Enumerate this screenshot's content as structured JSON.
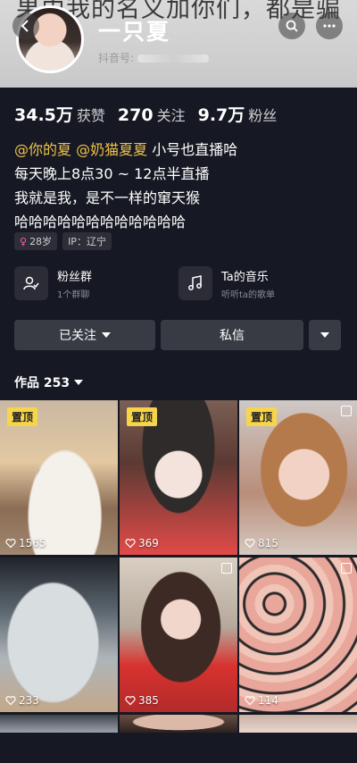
{
  "banner": {
    "text": "果由我的名义加你们，都是骗"
  },
  "profile": {
    "username": "一只夏",
    "douyin_id_label": "抖音号:"
  },
  "stats": [
    {
      "num": "34.5万",
      "label": "获赞"
    },
    {
      "num": "270",
      "label": "关注"
    },
    {
      "num": "9.7万",
      "label": "粉丝"
    }
  ],
  "bio": {
    "mention1": "@你的夏",
    "mention2": "@奶猫夏夏",
    "line1_rest": " 小号也直播哈",
    "line2": "每天晚上8点30 ~ 12点半直播",
    "line3": "我就是我，是不一样的窜天猴",
    "line4": "哈哈哈哈哈哈哈哈哈哈哈哈"
  },
  "tags": {
    "age": "28岁",
    "ip": "IP：辽宁",
    "gender_icon": "female-icon"
  },
  "cards": [
    {
      "title": "粉丝群",
      "sub": "1个群聊",
      "icon": "fan-group-icon"
    },
    {
      "title": "Ta的音乐",
      "sub": "听听ta的歌单",
      "icon": "music-note-icon"
    }
  ],
  "actions": {
    "follow": "已关注",
    "message": "私信"
  },
  "works": {
    "label": "作品 253"
  },
  "grid": [
    {
      "pin": "置顶",
      "likes": "1565"
    },
    {
      "pin": "置顶",
      "likes": "369"
    },
    {
      "pin": "置顶",
      "likes": "815"
    },
    {
      "likes": "233"
    },
    {
      "likes": "385"
    },
    {
      "likes": "114"
    }
  ],
  "colors": {
    "background": "#161823",
    "mention": "#f1c24a",
    "pin": "#f7d54a",
    "button": "#393b44"
  }
}
